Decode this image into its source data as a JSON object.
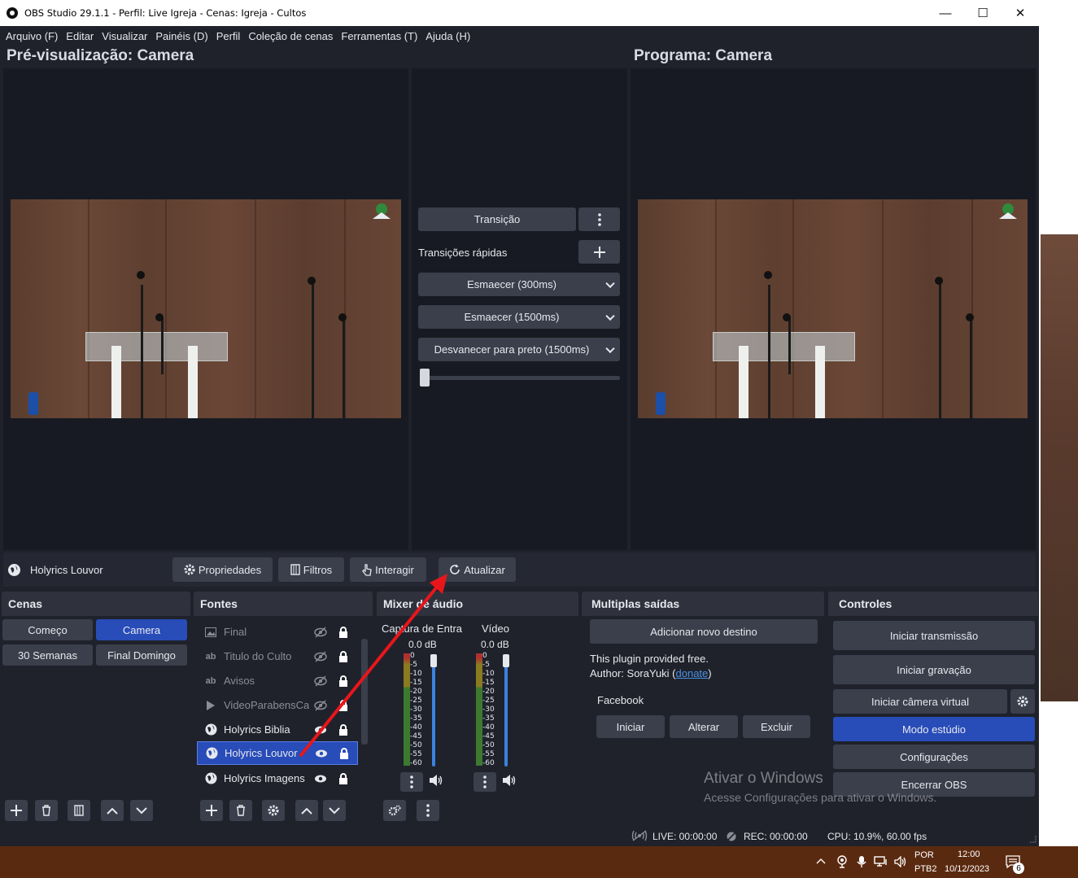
{
  "window": {
    "title": "OBS Studio 29.1.1 - Perfil: Live Igreja - Cenas: Igreja - Cultos",
    "minimize": "—",
    "maximize": "☐",
    "close": "✕"
  },
  "menu": [
    "Arquivo (F)",
    "Editar",
    "Visualizar",
    "Painéis (D)",
    "Perfil",
    "Coleção de cenas",
    "Ferramentas (T)",
    "Ajuda (H)"
  ],
  "preview": {
    "label": "Pré-visualização: Camera"
  },
  "program": {
    "label": "Programa: Camera"
  },
  "transitions": {
    "transition_button": "Transição",
    "quick_label": "Transições rápidas",
    "quick": [
      "Esmaecer (300ms)",
      "Esmaecer (1500ms)",
      "Desvanecer para preto (1500ms)"
    ]
  },
  "source_toolbar": {
    "selected_source": "Holyrics Louvor",
    "properties": "Propriedades",
    "filters": "Filtros",
    "interact": "Interagir",
    "refresh": "Atualizar"
  },
  "scenes": {
    "title": "Cenas",
    "items": [
      "Começo",
      "Camera",
      "30 Semanas",
      "Final Domingo"
    ],
    "selected": "Camera"
  },
  "sources": {
    "title": "Fontes",
    "items": [
      {
        "name": "Final",
        "type": "image"
      },
      {
        "name": "Titulo do Culto",
        "type": "text"
      },
      {
        "name": "Avisos",
        "type": "text"
      },
      {
        "name": "VideoParabensCa",
        "type": "media"
      },
      {
        "name": "Holyrics Biblia",
        "type": "browser"
      },
      {
        "name": "Holyrics Louvor",
        "type": "browser"
      },
      {
        "name": "Holyrics Imagens",
        "type": "browser"
      }
    ]
  },
  "mixer": {
    "title": "Mixer de áudio",
    "channels": [
      {
        "name": "Captura de Entra",
        "level": "0.0 dB"
      },
      {
        "name": "Vídeo",
        "level": "0.0 dB"
      }
    ],
    "scale": [
      "0",
      "-5",
      "-10",
      "-15",
      "-20",
      "-25",
      "-30",
      "-35",
      "-40",
      "-45",
      "-50",
      "-55",
      "-60"
    ]
  },
  "multi_output": {
    "title": "Multiplas saídas",
    "add_button": "Adicionar novo destino",
    "info_line1": "This plugin provided free.",
    "info_line2_prefix": "Author: SoraYuki (",
    "donate_link": "donate",
    "info_line2_suffix": ")",
    "destination": "Facebook",
    "start": "Iniciar",
    "edit": "Alterar",
    "delete": "Excluir"
  },
  "controls": {
    "title": "Controles",
    "start_stream": "Iniciar transmissão",
    "start_record": "Iniciar gravação",
    "start_vcam": "Iniciar câmera virtual",
    "studio_mode": "Modo estúdio",
    "settings": "Configurações",
    "exit": "Encerrar OBS"
  },
  "watermark": {
    "line1": "Ativar o Windows",
    "line2": "Acesse Configurações para ativar o Windows."
  },
  "status": {
    "live": "LIVE: 00:00:00",
    "rec": "REC: 00:00:00",
    "cpu": "CPU: 10.9%, 60.00 fps"
  },
  "taskbar": {
    "lang1": "POR",
    "lang2": "PTB2",
    "time": "12:00",
    "date": "10/12/2023",
    "notifications": "6"
  },
  "colors": {
    "accent": "#284cb8",
    "window_bg": "#1f222b",
    "button_bg": "#3b3f4b",
    "annotation_arrow": "#e8161b"
  }
}
